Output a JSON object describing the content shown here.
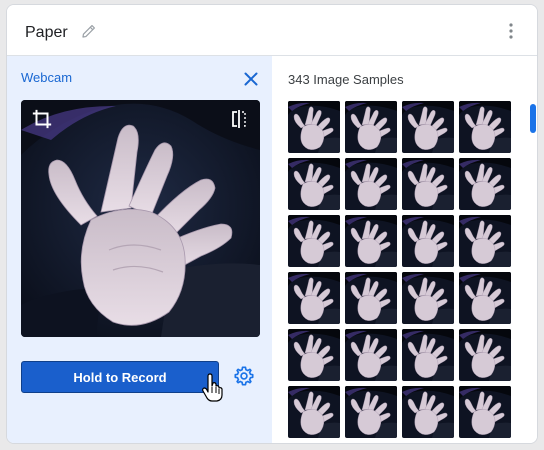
{
  "class_card": {
    "name": "Paper",
    "edit_icon": "pencil-icon",
    "menu_icon": "more-vert-icon"
  },
  "webcam": {
    "label": "Webcam",
    "close_icon": "close-icon",
    "crop_icon": "crop-icon",
    "flip_icon": "flip-icon",
    "record_button_label": "Hold to Record",
    "settings_icon": "settings-gear-icon"
  },
  "samples": {
    "count_label": "343 Image Samples",
    "visible_thumbnails": 24
  },
  "colors": {
    "accent": "#1a73e8",
    "record_button": "#1a5fcc",
    "panel_background": "#e8f0fe"
  }
}
